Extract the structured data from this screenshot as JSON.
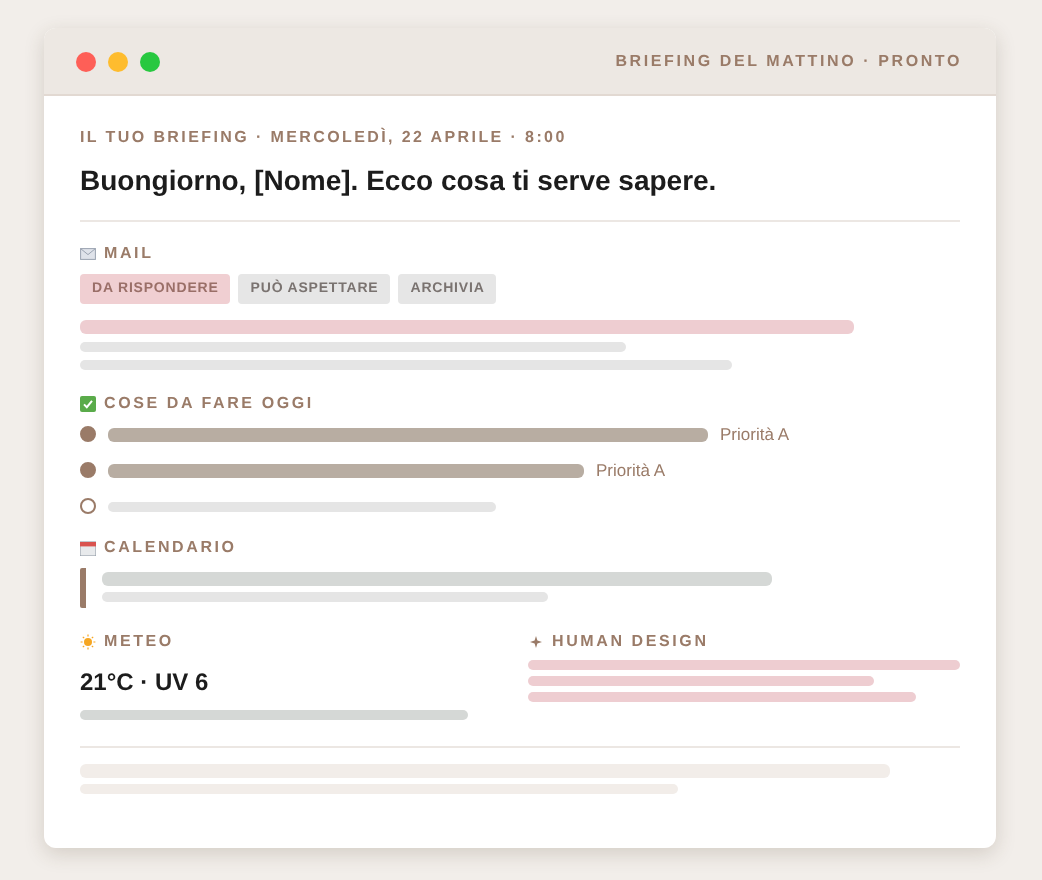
{
  "window": {
    "title": "BRIEFING DEL MATTINO · PRONTO"
  },
  "briefing": {
    "eyebrow": "IL TUO BRIEFING · MERCOLEDÌ, 22 APRILE · 8:00",
    "headline": "Buongiorno, [Nome]. Ecco cosa ti serve sapere."
  },
  "mail": {
    "title": "MAIL",
    "tabs": [
      {
        "label": "DA RISPONDERE",
        "selected": true
      },
      {
        "label": "PUÒ ASPETTARE",
        "selected": false
      },
      {
        "label": "ARCHIVIA",
        "selected": false
      }
    ]
  },
  "todos": {
    "title": "COSE DA FARE OGGI",
    "items": [
      {
        "checked": true,
        "tag": "Priorità A"
      },
      {
        "checked": true,
        "tag": "Priorità A"
      },
      {
        "checked": false
      }
    ]
  },
  "calendar": {
    "title": "CALENDARIO"
  },
  "weather": {
    "title": "METEO",
    "reading": "21°C · UV 6"
  },
  "human_design": {
    "title": "HUMAN DESIGN"
  }
}
